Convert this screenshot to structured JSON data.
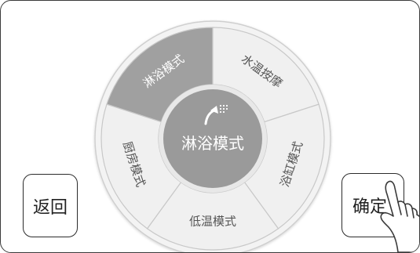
{
  "dial": {
    "center_label": "淋浴模式",
    "segments": [
      {
        "label": "淋浴模式",
        "selected": true
      },
      {
        "label": "水温按摩",
        "selected": false
      },
      {
        "label": "浴缸模式",
        "selected": false
      },
      {
        "label": "低温模式",
        "selected": false
      },
      {
        "label": "厨房模式",
        "selected": false
      }
    ]
  },
  "buttons": {
    "back_label": "返回",
    "confirm_label": "确定"
  },
  "colors": {
    "segment_selected": "#a0a0a0",
    "segment_default": "#f0f0f0",
    "center": "#9a9a9a",
    "outline": "#c8c8c8"
  },
  "icons": {
    "center_icon": "shower-head-icon",
    "hand_icon": "pointing-hand-icon"
  }
}
